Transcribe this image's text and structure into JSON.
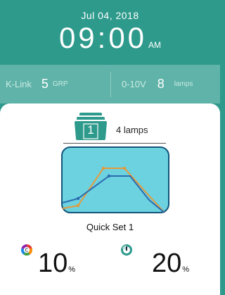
{
  "header": {
    "date": "Jul 04,  2018",
    "time": "09:00",
    "ampm": "AM"
  },
  "info_bar": {
    "link_label": "K-Link",
    "group_value": "5",
    "group_unit": "GRP",
    "signal_label": "0-10V",
    "lamps_value": "8",
    "lamps_unit": "lamps"
  },
  "group": {
    "number": "1",
    "lamps_label": "4 lamps"
  },
  "preset": {
    "name": "Quick Set 1"
  },
  "readouts": {
    "cct_value": "10",
    "cct_unit": "%",
    "dim_value": "20",
    "dim_unit": "%"
  },
  "colors": {
    "brand": "#2e9a8c",
    "bar": "#5fb3a8",
    "preview_bg": "#6cd2e0",
    "preview_border": "#14557a",
    "line_blue": "#2b6cb0",
    "line_orange": "#e39a3c"
  },
  "icons": {
    "group": "folder-stack-icon",
    "cct": "color-wheel-icon",
    "dim": "dimmer-icon"
  }
}
